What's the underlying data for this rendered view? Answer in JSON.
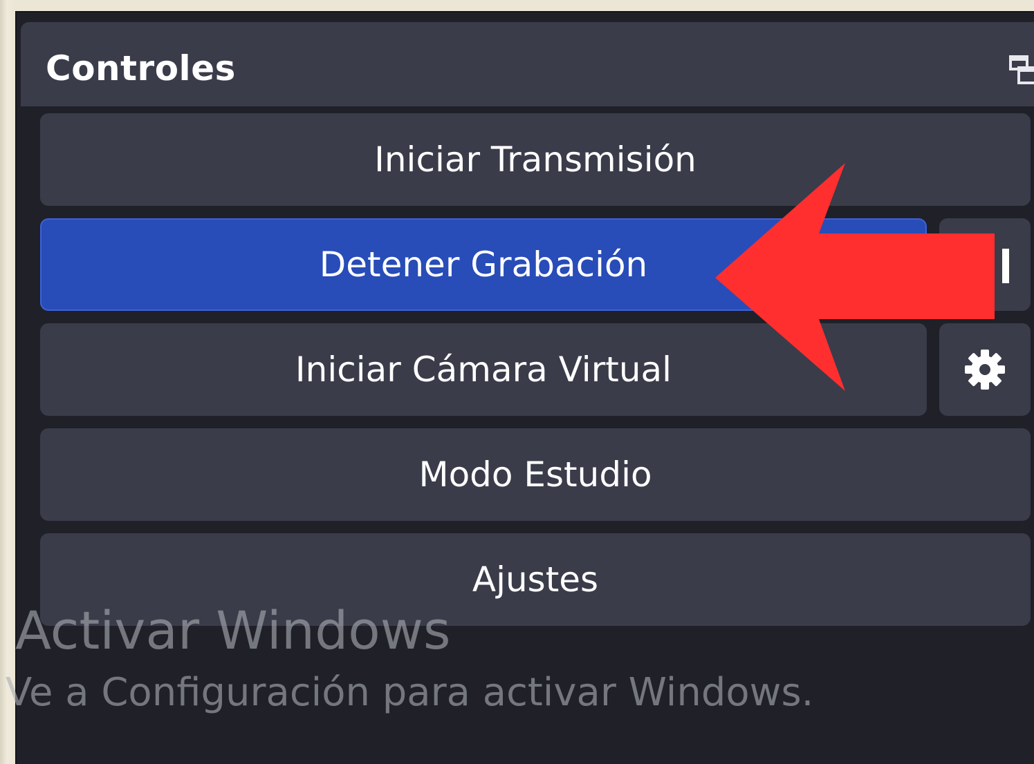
{
  "dock": {
    "title": "Controles",
    "float_icon": "float-dock-icon"
  },
  "buttons": {
    "start_stream": "Iniciar Transmisión",
    "stop_recording": "Detener Grabación",
    "start_virtual_cam": "Iniciar Cámara Virtual",
    "studio_mode": "Modo Estudio",
    "settings": "Ajustes"
  },
  "side_buttons": {
    "pause_icon": "pause-icon",
    "virtual_cam_settings_icon": "gear-icon"
  },
  "watermark": {
    "title": "Activar Windows",
    "subtitle": "Ve a Configuración para activar Windows."
  },
  "colors": {
    "accent_active": "#284cb8",
    "annotation_arrow": "#ff2f2f",
    "panel": "#3a3c4a",
    "dock_background": "#1f2028"
  }
}
